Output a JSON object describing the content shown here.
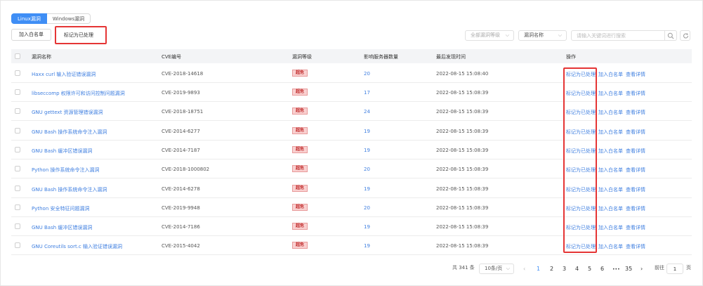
{
  "tabs": [
    {
      "label": "Linux漏洞",
      "active": true
    },
    {
      "label": "Windows漏洞",
      "active": false
    }
  ],
  "toolbar": {
    "whitelist_label": "加入白名单",
    "mark_label": "标记为已处理"
  },
  "filters": {
    "level_select": "全部漏洞等级",
    "name_select": "漏洞名称",
    "search_placeholder": "请输入关键词进行搜索"
  },
  "colors": {
    "accent": "#3f8ef5",
    "highlight": "#e53535",
    "badge_bg": "#f9d0d0",
    "badge_text": "#c02b2b"
  },
  "table": {
    "columns": [
      "漏洞名称",
      "CVE编号",
      "漏洞等级",
      "影响服务器数量",
      "最后发现时间",
      "操作"
    ],
    "rows": [
      {
        "name": "Haxx curl 输入验证错误漏洞",
        "cve": "CVE-2018-14618",
        "level": "超危",
        "count": "20",
        "time": "2022-08-15 15:08:40"
      },
      {
        "name": "libseccomp 权限许可和访问控制问题漏洞",
        "cve": "CVE-2019-9893",
        "level": "超危",
        "count": "17",
        "time": "2022-08-15 15:08:39"
      },
      {
        "name": "GNU gettext 资源管理错误漏洞",
        "cve": "CVE-2018-18751",
        "level": "超危",
        "count": "24",
        "time": "2022-08-15 15:08:39"
      },
      {
        "name": "GNU Bash 操作系统命令注入漏洞",
        "cve": "CVE-2014-6277",
        "level": "超危",
        "count": "19",
        "time": "2022-08-15 15:08:39"
      },
      {
        "name": "GNU Bash 缓冲区错误漏洞",
        "cve": "CVE-2014-7187",
        "level": "超危",
        "count": "19",
        "time": "2022-08-15 15:08:39"
      },
      {
        "name": "Python 操作系统命令注入漏洞",
        "cve": "CVE-2018-1000802",
        "level": "超危",
        "count": "20",
        "time": "2022-08-15 15:08:39"
      },
      {
        "name": "GNU Bash 操作系统命令注入漏洞",
        "cve": "CVE-2014-6278",
        "level": "超危",
        "count": "19",
        "time": "2022-08-15 15:08:39"
      },
      {
        "name": "Python 安全特征问题漏洞",
        "cve": "CVE-2019-9948",
        "level": "超危",
        "count": "20",
        "time": "2022-08-15 15:08:39"
      },
      {
        "name": "GNU Bash 缓冲区错误漏洞",
        "cve": "CVE-2014-7186",
        "level": "超危",
        "count": "19",
        "time": "2022-08-15 15:08:39"
      },
      {
        "name": "GNU Coreutils sort.c 输入验证错误漏洞",
        "cve": "CVE-2015-4042",
        "level": "超危",
        "count": "19",
        "time": "2022-08-15 15:08:39"
      }
    ],
    "actions": [
      "标记为已处理",
      "加入白名单",
      "查看详情"
    ]
  },
  "pagination": {
    "total": "共 341 条",
    "page_size": "10条/页",
    "pages": [
      "1",
      "2",
      "3",
      "4",
      "5",
      "6",
      "35"
    ],
    "ellipsis": "•••",
    "current": "1",
    "goto_label": "前往",
    "goto_value": "1",
    "page_unit": "页"
  }
}
